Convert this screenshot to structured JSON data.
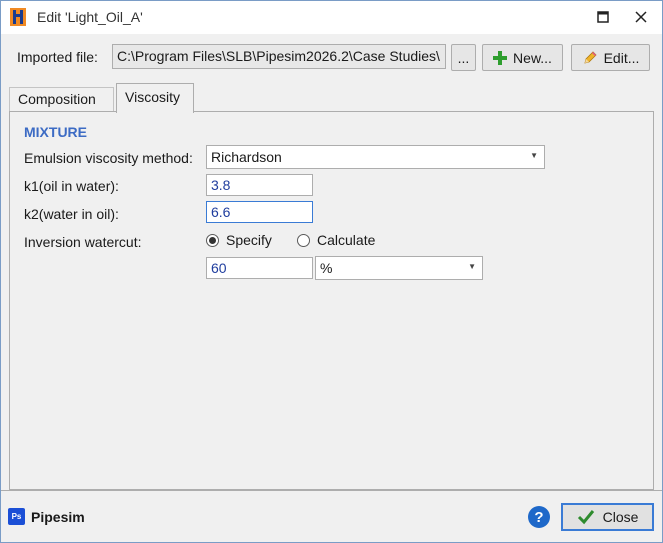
{
  "window": {
    "title": "Edit 'Light_Oil_A'"
  },
  "import": {
    "label": "Imported file:",
    "path": "C:\\Program Files\\SLB\\Pipesim2026.2\\Case Studies\\",
    "browse_label": "...",
    "new_label": "New...",
    "edit_label": "Edit..."
  },
  "tabs": [
    {
      "label": "Composition"
    },
    {
      "label": "Viscosity",
      "active": true
    }
  ],
  "mixture": {
    "section_title": "MIXTURE",
    "emulsion_label": "Emulsion viscosity method:",
    "emulsion_value": "Richardson",
    "k1_label": "k1(oil in water):",
    "k1_value": "3.8",
    "k2_label": "k2(water in oil):",
    "k2_value": "6.6",
    "inversion_label": "Inversion watercut:",
    "specify_label": "Specify",
    "calculate_label": "Calculate",
    "selected_option": "Specify",
    "watercut_value": "60",
    "watercut_unit": "%"
  },
  "footer": {
    "brand": "Pipesim",
    "brand_badge": "Ps",
    "help_label": "?",
    "close_label": "Close"
  },
  "colors": {
    "accent": "#3c6bc4",
    "help": "#1e68c9",
    "new_plus": "#2e9e2e"
  }
}
